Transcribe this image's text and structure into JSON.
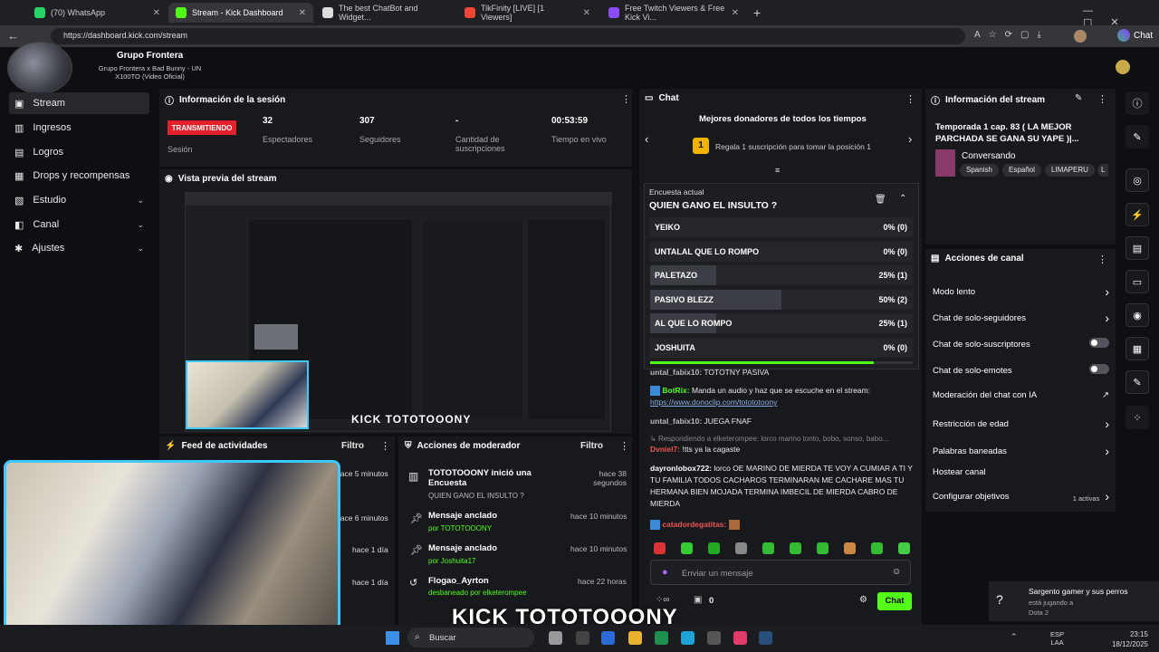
{
  "browser": {
    "tabs": [
      {
        "label": "(70) WhatsApp"
      },
      {
        "label": "Stream - Kick Dashboard"
      },
      {
        "label": "The best ChatBot and Widget..."
      },
      {
        "label": "TikFinity [LIVE] [1 Viewers]"
      },
      {
        "label": "Free Twitch Viewers & Free Kick Vi..."
      }
    ],
    "url": "https://dashboard.kick.com/stream",
    "chat_btn": "Chat"
  },
  "now_playing": {
    "artist": "Grupo Frontera",
    "song": "Grupo Frontera x Bad Bunny - UN X100TO (Video Oficial)"
  },
  "sidebar": {
    "items": [
      {
        "label": "Stream"
      },
      {
        "label": "Ingresos"
      },
      {
        "label": "Logros"
      },
      {
        "label": "Drops y recompensas"
      },
      {
        "label": "Estudio"
      },
      {
        "label": "Canal"
      },
      {
        "label": "Ajustes"
      }
    ]
  },
  "session": {
    "title": "Información de la sesión",
    "badge": "TRANSMITIENDO",
    "badge_label": "Sesión",
    "stats": [
      {
        "value": "32",
        "label": "Espectadores"
      },
      {
        "value": "307",
        "label": "Seguidores"
      },
      {
        "value": "-",
        "label": "Cantidad de suscripciones"
      },
      {
        "value": "00:53:59",
        "label": "Tiempo en vivo"
      }
    ]
  },
  "preview": {
    "title": "Vista previa del stream",
    "overlay": "KICK TOTOTOOONY"
  },
  "feed": {
    "title": "Feed de actividades",
    "filter": "Filtro",
    "times": [
      "hace 5 minutos",
      "hace 6 minutos",
      "hace 1 día",
      "hace 1 día"
    ]
  },
  "mod": {
    "title": "Acciones de moderador",
    "filter": "Filtro",
    "rows": [
      {
        "title": "TOTOTOOONY inició una Encuesta",
        "sub": "QUIEN GANO EL INSULTO ?",
        "time": "hace 38 segundos"
      },
      {
        "title": "Mensaje anclado",
        "sub": "por TOTOTOOONY",
        "time": "hace 10 minutos"
      },
      {
        "title": "Mensaje anclado",
        "sub": "por Joshuita17",
        "time": "hace 10 minutos"
      },
      {
        "title": "Flogao_Ayrton",
        "sub": "desbaneado por elketerompee",
        "time": "hace 22 horas"
      }
    ]
  },
  "chat": {
    "title": "Chat",
    "donors_title": "Mejores donadores de todos los tiempos",
    "donor_rank": "1",
    "donor_text": "Regala 1 suscripción para tomar la posición 1",
    "poll": {
      "label": "Encuesta actual",
      "question": "QUIEN GANO EL INSULTO ?",
      "options": [
        {
          "name": "YEIKO",
          "pct": "0% (0)",
          "frac": 0
        },
        {
          "name": "UNTALAL QUE LO ROMPO",
          "pct": "0% (0)",
          "frac": 0
        },
        {
          "name": "PALETAZO",
          "pct": "25% (1)",
          "frac": 0.25
        },
        {
          "name": "PASIVO BLEZZ",
          "pct": "50% (2)",
          "frac": 0.5
        },
        {
          "name": "AL QUE LO ROMPO",
          "pct": "25% (1)",
          "frac": 0.25
        },
        {
          "name": "JOSHUITA",
          "pct": "0% (0)",
          "frac": 0
        }
      ],
      "progress": 0.85
    },
    "messages": [
      {
        "user": "untal_fabix10:",
        "text": "TOTOTNY PASIVA"
      },
      {
        "user": "BotRix:",
        "text": "Manda un audio y haz que se escuche en el stream:",
        "link": "https://www.donoclip.com/totototoony"
      },
      {
        "user": "untal_fabix10:",
        "text": "JUEGA FNAF"
      },
      {
        "reply": "Respondiendo a elketerompee: lorco marino tonto, bobo, sonso, babo..."
      },
      {
        "user": "Dvniel7:",
        "text": "!tts ya la cagaste"
      },
      {
        "user": "dayronlobox722:",
        "text": "lorco OE MARINO DE MIERDA TE VOY A CUMIAR A TI Y TU FAMILIA TODOS CACHAROS TERMINARAN ME CACHARE MAS TU HERMANA BIEN MOJADA TERMINA IMBECIL DE MIERDA CABRO DE MIERDA"
      },
      {
        "user": "catadordegatitas:",
        "text": ""
      }
    ],
    "input_placeholder": "Enviar un mensaje",
    "count": "0",
    "send": "Chat"
  },
  "stream_info": {
    "title": "Información del stream",
    "stream_title": "Temporada 1 cap. 83 ( LA MEJOR PARCHADA SE GANA SU YAPE )|...",
    "category": "Conversando",
    "tags": [
      "Spanish",
      "Español",
      "LIMAPERU",
      "L"
    ]
  },
  "channel_actions": {
    "title": "Acciones de canal",
    "items": [
      {
        "label": "Modo lento",
        "ctrl": "chevron"
      },
      {
        "label": "Chat de solo-seguidores",
        "ctrl": "chevron"
      },
      {
        "label": "Chat de solo-suscriptores",
        "ctrl": "toggle"
      },
      {
        "label": "Chat de solo-emotes",
        "ctrl": "toggle"
      },
      {
        "label": "Moderación del chat con IA",
        "ctrl": "external"
      },
      {
        "label": "Restricción de edad",
        "ctrl": "chevron"
      },
      {
        "label": "Palabras baneadas",
        "ctrl": "chevron"
      },
      {
        "label": "Hostear canal",
        "ctrl": "none"
      },
      {
        "label": "Configurar objetivos",
        "ctrl": "chevron",
        "extra": "1 activas"
      }
    ]
  },
  "notification": {
    "title": "Sargento gamer y sus perros",
    "sub": "está jugando a",
    "game": "Dota 2"
  },
  "overlay_bottom": "KICK TOTOTOOONY",
  "taskbar": {
    "search": "Buscar",
    "lang": "ESP",
    "lang2": "LAA",
    "time": "23:15",
    "date": "18/12/2025"
  }
}
